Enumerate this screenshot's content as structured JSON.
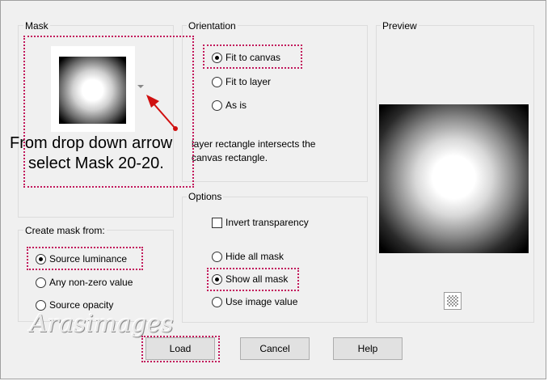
{
  "mask": {
    "title": "Mask",
    "annotation_line1": "From drop down arrow",
    "annotation_line2": "select Mask 20-20."
  },
  "orientation": {
    "title": "Orientation",
    "options": [
      {
        "label": "Fit to canvas",
        "checked": true
      },
      {
        "label": "Fit to layer",
        "checked": false
      },
      {
        "label": "As is",
        "checked": false
      }
    ],
    "info_line1": "layer rectangle intersects the",
    "info_line2": "canvas rectangle."
  },
  "preview": {
    "title": "Preview"
  },
  "create_from": {
    "title": "Create mask from:",
    "options": [
      {
        "label": "Source luminance",
        "checked": true
      },
      {
        "label": "Any non-zero value",
        "checked": false
      },
      {
        "label": "Source opacity",
        "checked": false
      }
    ]
  },
  "options": {
    "title": "Options",
    "invert_label": "Invert transparency",
    "invert_checked": false,
    "radios": [
      {
        "label": "Hide all mask",
        "checked": false
      },
      {
        "label": "Show all mask",
        "checked": true
      },
      {
        "label": "Use image value",
        "checked": false
      }
    ]
  },
  "buttons": {
    "load": "Load",
    "cancel": "Cancel",
    "help": "Help"
  },
  "watermark": "Arasimages",
  "colors": {
    "annotation": "#c2185b",
    "dialog_bg": "#f0f0f0"
  },
  "icons": {
    "mask_dropdown": "chevron-down-icon",
    "annotation_arrow": "arrow-icon",
    "preview_background": "checkerboard-icon"
  }
}
